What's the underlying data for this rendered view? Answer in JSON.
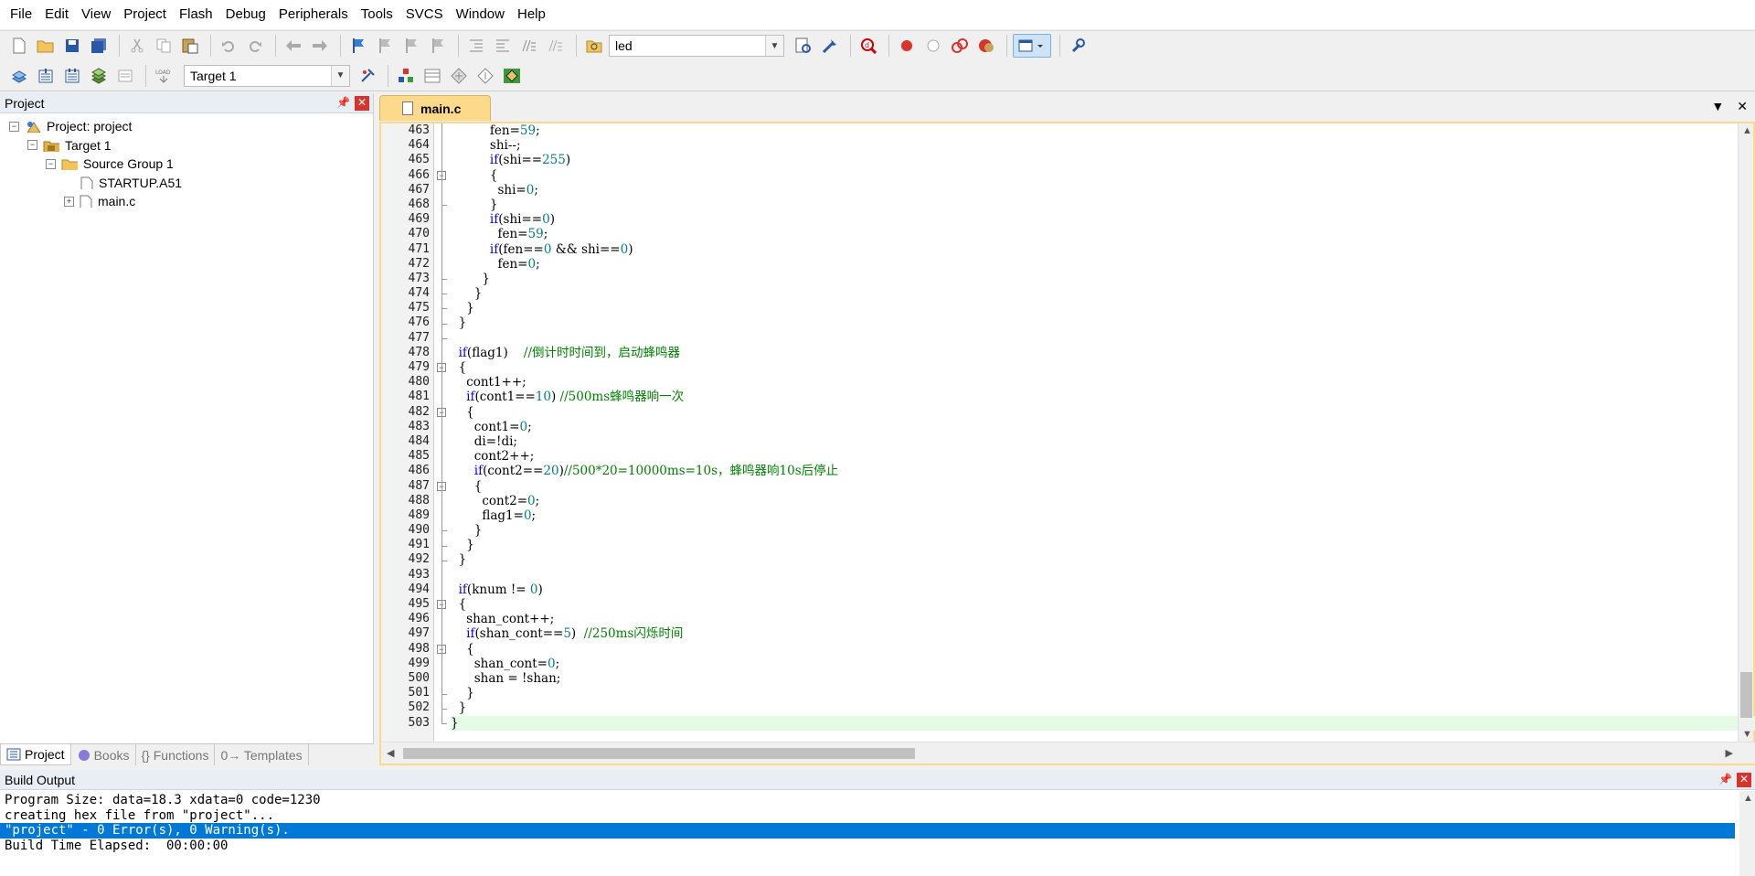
{
  "menu": [
    "File",
    "Edit",
    "View",
    "Project",
    "Flash",
    "Debug",
    "Peripherals",
    "Tools",
    "SVCS",
    "Window",
    "Help"
  ],
  "toolbar": {
    "find_value": "led",
    "target_value": "Target 1"
  },
  "project_panel": {
    "title": "Project",
    "tree": {
      "root": "Project: project",
      "target": "Target 1",
      "group": "Source Group 1",
      "files": [
        "STARTUP.A51",
        "main.c"
      ]
    },
    "tabs": [
      "Project",
      "Books",
      "{} Functions",
      "0→ Templates"
    ]
  },
  "editor": {
    "tab_title": "main.c",
    "line_numbers": [
      "463",
      "464",
      "465",
      "466",
      "467",
      "468",
      "469",
      "470",
      "471",
      "472",
      "473",
      "474",
      "475",
      "476",
      "477",
      "478",
      "479",
      "480",
      "481",
      "482",
      "483",
      "484",
      "485",
      "486",
      "487",
      "488",
      "489",
      "490",
      "491",
      "492",
      "493",
      "494",
      "495",
      "496",
      "497",
      "498",
      "499",
      "500",
      "501",
      "502",
      "503"
    ]
  },
  "build_output": {
    "title": "Build Output",
    "lines": [
      "Program Size: data=18.3 xdata=0 code=1230",
      "creating hex file from \"project\"...",
      "\"project\" - 0 Error(s), 0 Warning(s).",
      "Build Time Elapsed:  00:00:00"
    ]
  },
  "colors": {
    "keyword": "#0000ff",
    "number": "#008080",
    "comment": "#008000",
    "tab_active": "#fcd98b",
    "selection": "#0078d7"
  }
}
